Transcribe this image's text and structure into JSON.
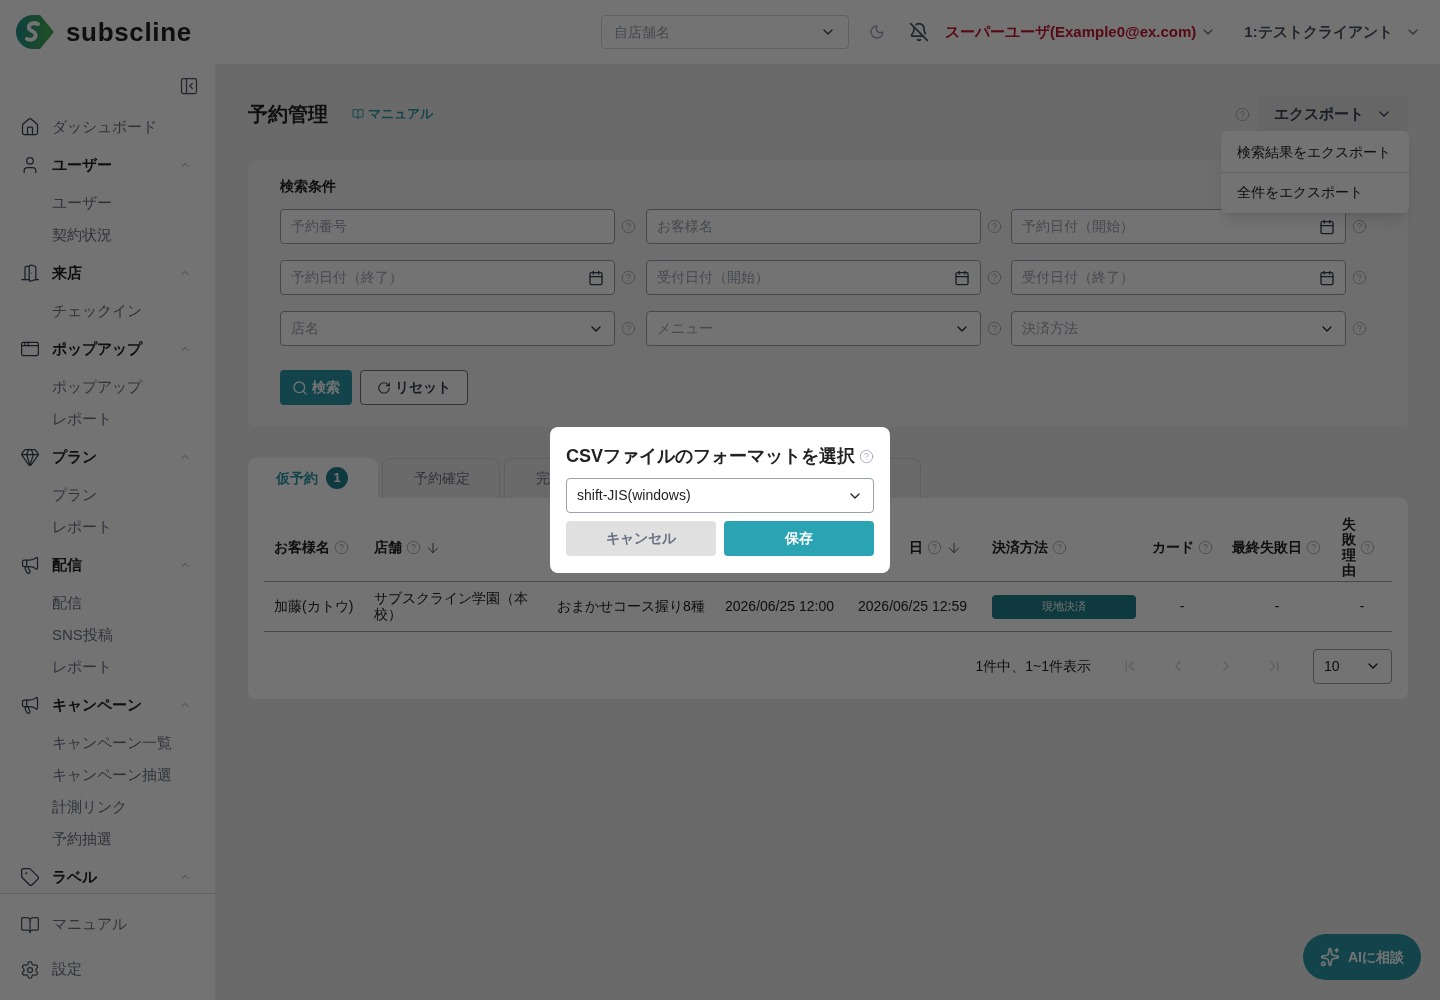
{
  "header": {
    "logo": "subscline",
    "store_select": {
      "placeholder": "自店舗名"
    },
    "user": "スーパーユーザ(Example0@ex.com)",
    "client": "1:テストクライアント"
  },
  "sidebar": {
    "items": [
      {
        "label": "ダッシュボード",
        "kind": "link"
      },
      {
        "label": "ユーザー",
        "kind": "group",
        "expanded": true,
        "children": [
          {
            "label": "ユーザー"
          },
          {
            "label": "契約状況"
          }
        ]
      },
      {
        "label": "来店",
        "kind": "group",
        "expanded": true,
        "children": [
          {
            "label": "チェックイン"
          }
        ]
      },
      {
        "label": "ポップアップ",
        "kind": "group",
        "expanded": true,
        "children": [
          {
            "label": "ポップアップ"
          },
          {
            "label": "レポート"
          }
        ]
      },
      {
        "label": "プラン",
        "kind": "group",
        "expanded": true,
        "children": [
          {
            "label": "プラン"
          },
          {
            "label": "レポート"
          }
        ]
      },
      {
        "label": "配信",
        "kind": "group",
        "expanded": true,
        "children": [
          {
            "label": "配信"
          },
          {
            "label": "SNS投稿"
          },
          {
            "label": "レポート"
          }
        ]
      },
      {
        "label": "キャンペーン",
        "kind": "group",
        "expanded": true,
        "children": [
          {
            "label": "キャンペーン一覧"
          },
          {
            "label": "キャンペーン抽選"
          },
          {
            "label": "計測リンク"
          },
          {
            "label": "予約抽選"
          }
        ]
      },
      {
        "label": "ラベル",
        "kind": "group",
        "expanded": true
      }
    ],
    "footer": [
      {
        "label": "マニュアル"
      },
      {
        "label": "設定"
      }
    ]
  },
  "page": {
    "title": "予約管理",
    "manual_link": "マニュアル",
    "export_button": "エクスポート",
    "export_menu": [
      "検索結果をエクスポート",
      "全件をエクスポート"
    ]
  },
  "search": {
    "title": "検索条件",
    "fields": [
      {
        "placeholder": "予約番号",
        "kind": "text"
      },
      {
        "placeholder": "お客様名",
        "kind": "text"
      },
      {
        "placeholder": "予約日付（開始）",
        "kind": "date"
      },
      {
        "placeholder": "予約日付（終了）",
        "kind": "date"
      },
      {
        "placeholder": "受付日付（開始）",
        "kind": "date"
      },
      {
        "placeholder": "受付日付（終了）",
        "kind": "date"
      },
      {
        "placeholder": "店名",
        "kind": "select"
      },
      {
        "placeholder": "メニュー",
        "kind": "select"
      },
      {
        "placeholder": "決済方法",
        "kind": "select"
      }
    ],
    "search_button": "検索",
    "reset_button": "リセット"
  },
  "tabs": [
    {
      "label": "仮予約",
      "badge": "1",
      "selected": true
    },
    {
      "label": "予約確定",
      "selected": false
    },
    {
      "label": "完",
      "selected": false
    },
    {
      "selected": false
    }
  ],
  "table": {
    "columns": [
      {
        "label": "お客様名",
        "help": true
      },
      {
        "label": "店舗",
        "help": true,
        "sort": true
      },
      {},
      {},
      {
        "label": "日",
        "help": true,
        "sort": true
      },
      {
        "label": "決済方法",
        "help": true
      },
      {
        "label": "カード",
        "help": true
      },
      {
        "label": "最終失敗日",
        "help": true
      },
      {
        "label": "失敗理由",
        "help": true,
        "vertical": true
      }
    ],
    "rows": [
      {
        "cells": [
          "加藤(カトウ)",
          "サブスクライン学園（本校）",
          "おまかせコース握り8種",
          "2026/06/25 12:00",
          "2026/06/25 12:59",
          "現地決済",
          "-",
          "-",
          "-"
        ]
      }
    ]
  },
  "pagination": {
    "summary": "1件中、1~1件表示",
    "page_size": "10",
    "first_disabled": true,
    "prev_disabled": true,
    "next_disabled": true,
    "last_disabled": true
  },
  "ai_button": "AIに相談",
  "modal": {
    "title": "CSVファイルのフォーマットを選択",
    "format": "shift-JIS(windows)",
    "cancel": "キャンセル",
    "save": "保存"
  }
}
